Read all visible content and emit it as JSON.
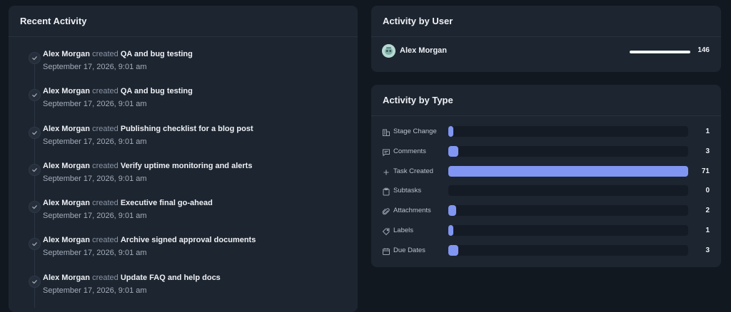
{
  "recent_activity": {
    "title": "Recent Activity",
    "items": [
      {
        "user": "Alex Morgan",
        "verb": "created",
        "title": "QA and bug testing",
        "time": "September 17, 2026, 9:01 am"
      },
      {
        "user": "Alex Morgan",
        "verb": "created",
        "title": "QA and bug testing",
        "time": "September 17, 2026, 9:01 am"
      },
      {
        "user": "Alex Morgan",
        "verb": "created",
        "title": "Publishing checklist for a blog post",
        "time": "September 17, 2026, 9:01 am"
      },
      {
        "user": "Alex Morgan",
        "verb": "created",
        "title": "Verify uptime monitoring and alerts",
        "time": "September 17, 2026, 9:01 am"
      },
      {
        "user": "Alex Morgan",
        "verb": "created",
        "title": "Executive final go-ahead",
        "time": "September 17, 2026, 9:01 am"
      },
      {
        "user": "Alex Morgan",
        "verb": "created",
        "title": "Archive signed approval documents",
        "time": "September 17, 2026, 9:01 am"
      },
      {
        "user": "Alex Morgan",
        "verb": "created",
        "title": "Update FAQ and help docs",
        "time": "September 17, 2026, 9:01 am"
      }
    ]
  },
  "activity_by_user": {
    "title": "Activity by User",
    "users": [
      {
        "name": "Alex Morgan",
        "count": "146",
        "share": 1.0
      }
    ]
  },
  "activity_by_type": {
    "title": "Activity by Type",
    "max": 71,
    "bar_color": "#8196f2",
    "types": [
      {
        "label": "Stage Change",
        "count": 1,
        "icon": "building-icon"
      },
      {
        "label": "Comments",
        "count": 3,
        "icon": "comment-icon"
      },
      {
        "label": "Task Created",
        "count": 71,
        "icon": "plus-icon"
      },
      {
        "label": "Subtasks",
        "count": 0,
        "icon": "clipboard-icon"
      },
      {
        "label": "Attachments",
        "count": 2,
        "icon": "paperclip-icon"
      },
      {
        "label": "Labels",
        "count": 1,
        "icon": "tag-icon"
      },
      {
        "label": "Due Dates",
        "count": 3,
        "icon": "calendar-icon"
      }
    ]
  }
}
